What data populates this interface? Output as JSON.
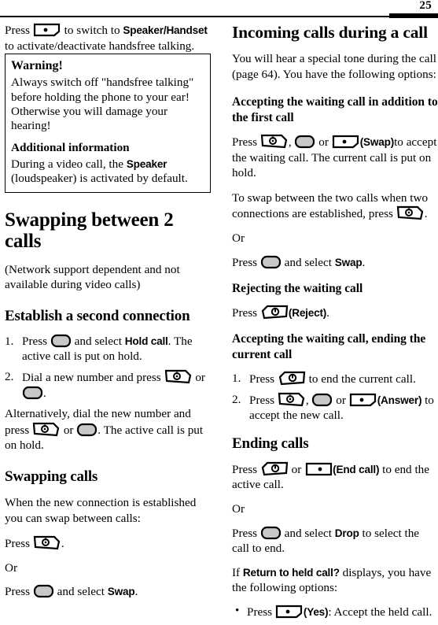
{
  "header": {
    "page_number": "25"
  },
  "left_column": {
    "intro": {
      "pre": "Press",
      "icon": "softkey-right-icon",
      "mid": "to switch to",
      "term1": "Speaker",
      "slash": "/",
      "term2": "Handset",
      "post": "to activate/deactivate handsfree talking."
    },
    "warning_box": {
      "warning_heading": "Warning!",
      "warning_body": "Always switch off \"handsfree talking\" before holding the phone to your ear! Otherwise you will damage your hearing!",
      "additional_heading": "Additional information",
      "additional_body_pre": "During a video call, the",
      "additional_term": "Speaker",
      "additional_body_post": "(loudspeaker) is activated by default."
    },
    "section_title": "Swapping between 2 calls",
    "section_note": "(Network support dependent and not available during video calls)",
    "establish": {
      "heading": "Establish a second connection",
      "step1": {
        "marker": "1.",
        "pre": "Press",
        "icon": "nav-key-icon",
        "mid": "and select",
        "term": "Hold call",
        "post": ". The active call is put on hold."
      },
      "step2": {
        "marker": "2.",
        "pre": "Dial a new number and press",
        "icon1": "call-key-icon",
        "mid": "or",
        "icon2": "nav-key-icon",
        "post": "."
      },
      "alt": {
        "pre": "Alternatively, dial the new number and press",
        "icon1": "call-key-icon",
        "mid": "or",
        "icon2": "nav-key-icon",
        "post": ". The active call is put on hold."
      }
    },
    "swapping": {
      "heading": "Swapping calls",
      "intro": "When the new connection is established you can swap between calls:",
      "line1_pre": "Press",
      "line1_icon": "call-key-icon",
      "line1_post": ".",
      "or": "Or",
      "line2_pre": "Press",
      "line2_icon": "nav-key-icon",
      "line2_mid": "and select",
      "line2_term": "Swap",
      "line2_post": "."
    }
  },
  "right_column": {
    "incoming": {
      "heading": "Incoming calls during a call",
      "body": "You will hear a special tone during the call (page 64). You have the following options:"
    },
    "accepting_addition": {
      "heading": "Accepting the waiting call in addition to the first call",
      "line_pre": "Press",
      "icon1": "call-key-icon",
      "comma": ",",
      "icon2": "nav-key-icon",
      "mid": "or",
      "icon3": "softkey-right-icon",
      "label": "(Swap)",
      "line_post": "to accept the waiting call. The current call is put on hold.",
      "swap_pre": "To swap between the two calls when two connections are established, press",
      "swap_icon": "call-key-icon",
      "swap_post": ".",
      "or": "Or",
      "or_pre": "Press",
      "or_icon": "nav-key-icon",
      "or_mid": "and select",
      "or_term": "Swap",
      "or_post": "."
    },
    "rejecting": {
      "heading": "Rejecting the waiting call",
      "line_pre": "Press",
      "icon": "end-key-icon",
      "label": "(Reject)",
      "line_post": "."
    },
    "accepting_ending": {
      "heading": "Accepting the waiting call, ending the current call",
      "step1": {
        "marker": "1.",
        "pre": "Press",
        "icon": "end-key-icon",
        "post": "to end the current call."
      },
      "step2": {
        "marker": "2.",
        "pre": "Press",
        "icon1": "call-key-icon",
        "comma": ",",
        "icon2": "nav-key-icon",
        "mid": "or",
        "icon3": "softkey-right-icon",
        "label": "(Answer)",
        "post": "to accept the new call."
      }
    },
    "ending": {
      "heading": "Ending calls",
      "line_pre": "Press",
      "icon1": "end-key-icon",
      "mid": "or",
      "icon2": "softkey-left-icon",
      "label": "(End call)",
      "line_post": "to end the active call.",
      "or": "Or",
      "or_pre": "Press",
      "or_icon": "nav-key-icon",
      "or_mid": "and select",
      "or_term": "Drop",
      "or_post": "to select the call to end.",
      "if_pre": "If",
      "if_term": "Return to held call?",
      "if_post": "displays, you have the following options:",
      "bullet1": {
        "marker": "•",
        "pre": "Press",
        "icon": "softkey-right-icon",
        "label": "(Yes)",
        "post": ": Accept the held call."
      }
    }
  },
  "colors": {
    "key_fill": "#c8c8c8",
    "ink": "#000000",
    "paper": "#ffffff"
  }
}
